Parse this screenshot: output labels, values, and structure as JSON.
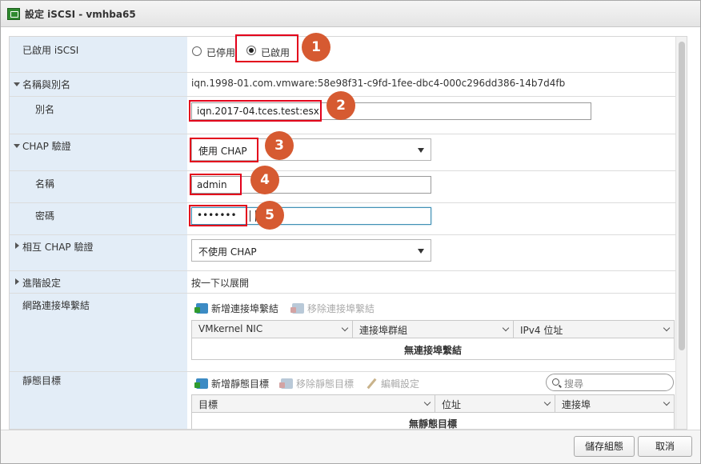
{
  "window": {
    "title": "設定 iSCSI - vmhba65"
  },
  "enabled_row": {
    "label": "已啟用 iSCSI",
    "options": [
      "已停用",
      "已啟用"
    ],
    "selected": "已啟用"
  },
  "name_alias": {
    "label": "名稱與別名",
    "iqn": "iqn.1998-01.com.vmware:58e98f31-c9fd-1fee-dbc4-000c296dd386-14b7d4fb",
    "alias_label": "別名",
    "alias_value": "iqn.2017-04.tces.test:esxi"
  },
  "chap": {
    "label": "CHAP 驗證",
    "method_value": "使用 CHAP",
    "name_label": "名稱",
    "name_value": "admin",
    "password_label": "密碼",
    "password_value": "•••••••"
  },
  "mutual_chap": {
    "label": "相互 CHAP 驗證",
    "method_value": "不使用 CHAP"
  },
  "advanced": {
    "label": "進階設定",
    "hint": "按一下以展開"
  },
  "port_binding": {
    "label": "網路連接埠繫結",
    "add_label": "新增連接埠繫結",
    "remove_label": "移除連接埠繫結",
    "columns": [
      "VMkernel NIC",
      "連接埠群組",
      "IPv4 位址"
    ],
    "empty": "無連接埠繫結"
  },
  "static_targets": {
    "label": "靜態目標",
    "add_label": "新增靜態目標",
    "remove_label": "移除靜態目標",
    "edit_label": "編輯設定",
    "search_placeholder": "搜尋",
    "columns": [
      "目標",
      "位址",
      "連接埠"
    ],
    "empty": "無靜態目標"
  },
  "footer": {
    "save_label": "儲存組態",
    "cancel_label": "取消"
  },
  "annotations": [
    "1",
    "2",
    "3",
    "4",
    "5"
  ],
  "colors": {
    "label_bg": "#e3edf7",
    "highlight": "#e3001b",
    "badge": "#d65a31"
  }
}
